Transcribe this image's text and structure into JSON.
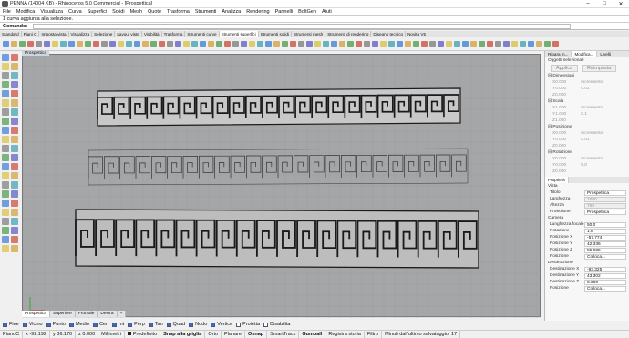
{
  "window": {
    "title": "PENNA (14004 KB) - Rhinoceros 5.0 Commercial - [Prospettica]"
  },
  "menu": [
    "File",
    "Modifica",
    "Visualizza",
    "Curva",
    "Superfici",
    "Solidi",
    "Mesh",
    "Quote",
    "Trasforma",
    "Strumenti",
    "Analizza",
    "Rendering",
    "Pannelli",
    "BoltGen",
    "Aiuti"
  ],
  "command": {
    "history": "1 curva aggiunta alla selezione.",
    "prompt": "Comando:"
  },
  "toolbar_tabs": [
    {
      "label": "Standard"
    },
    {
      "label": "Piani C"
    },
    {
      "label": "Imposta vista"
    },
    {
      "label": "Visualizza"
    },
    {
      "label": "Selezione"
    },
    {
      "label": "Layout viste"
    },
    {
      "label": "Visibilità"
    },
    {
      "label": "Trasforma"
    },
    {
      "label": "Strumenti curve"
    },
    {
      "label": "Strumenti superfici",
      "active": true
    },
    {
      "label": "Strumenti solidi"
    },
    {
      "label": "Strumenti mesh"
    },
    {
      "label": "Strumenti di rendering"
    },
    {
      "label": "Disegno tecnico"
    },
    {
      "label": "Novità V5"
    }
  ],
  "viewport": {
    "label": "Prospettica",
    "tabs": [
      "Prospettica",
      "Superiore",
      "Frontale",
      "Destra",
      "+"
    ]
  },
  "osnaps": [
    {
      "label": "Fine",
      "on": true
    },
    {
      "label": "Vicino",
      "on": true
    },
    {
      "label": "Punto",
      "on": true
    },
    {
      "label": "Medio",
      "on": true
    },
    {
      "label": "Cen",
      "on": true
    },
    {
      "label": "Int",
      "on": true
    },
    {
      "label": "Perp",
      "on": true
    },
    {
      "label": "Tan",
      "on": true
    },
    {
      "label": "Quad",
      "on": true
    },
    {
      "label": "Nodo",
      "on": true
    },
    {
      "label": "Vertice",
      "on": true
    },
    {
      "label": "Proietta",
      "on": false
    },
    {
      "label": "Disabilita",
      "on": false
    }
  ],
  "status": {
    "cplane": "PianoC",
    "x": "x -92.192",
    "y": "y 36.170",
    "z": "z 0.000",
    "units": "Millimetri",
    "layer": "Predefinito",
    "buttons": [
      "Snap alla griglia",
      "Orto",
      "Planare",
      "Osnap",
      "SmartTrack",
      "Gumball",
      "Registra storia",
      "Filtro"
    ],
    "message": "Minuti dall'ultimo salvataggio: 17"
  },
  "panel_top": {
    "tabs": [
      "Ripara m...",
      "Modifica...",
      "Livelli"
    ],
    "heading": "Oggetti selezionati",
    "mode_buttons": [
      "Applica",
      "Reimposta"
    ],
    "groups": [
      {
        "name": "Dimensioni",
        "rows": [
          {
            "axis": "X",
            "value": "0.000",
            "extra_label": "Incremento"
          },
          {
            "axis": "Y",
            "value": "0.000",
            "extra_value": "0.01"
          },
          {
            "axis": "Z",
            "value": "0.000"
          }
        ]
      },
      {
        "name": "Scala",
        "rows": [
          {
            "axis": "X",
            "value": "1.000",
            "extra_label": "Incremento"
          },
          {
            "axis": "Y",
            "value": "1.000",
            "extra_value": "0.1"
          },
          {
            "axis": "Z",
            "value": "1.000"
          }
        ]
      },
      {
        "name": "Posizione",
        "rows": [
          {
            "axis": "X",
            "value": "0.000",
            "extra_label": "Incremento"
          },
          {
            "axis": "Y",
            "value": "0.000",
            "extra_value": "0.01"
          },
          {
            "axis": "Z",
            "value": "0.000"
          }
        ]
      },
      {
        "name": "Rotazione",
        "rows": [
          {
            "axis": "X",
            "value": "0.000",
            "extra_label": "Incremento"
          },
          {
            "axis": "Y",
            "value": "0.000",
            "extra_value": "5.0"
          },
          {
            "axis": "Z",
            "value": "0.000"
          }
        ]
      }
    ]
  },
  "panel_props": {
    "tab": "Proprietà",
    "sections": [
      {
        "title": "Vista",
        "rows": [
          {
            "label": "Titolo",
            "value": "Prospettica"
          },
          {
            "label": "Larghezza",
            "value": "1080",
            "disabled": true
          },
          {
            "label": "Altezza",
            "value": "755",
            "disabled": true
          },
          {
            "label": "Proiezione",
            "value": "Prospettica"
          }
        ]
      },
      {
        "title": "Camera",
        "rows": [
          {
            "label": "Lunghezza focale",
            "value": "50.0"
          },
          {
            "label": "Rotazione",
            "value": "1.6"
          },
          {
            "label": "Posizione X",
            "value": "-57.774"
          },
          {
            "label": "Posizione Y",
            "value": "42.336"
          },
          {
            "label": "Posizione Z",
            "value": "56.686"
          },
          {
            "label": "Posizione",
            "value": "Colloca..."
          }
        ]
      },
      {
        "title": "Destinazione",
        "rows": [
          {
            "label": "Destinazione X",
            "value": "-93.325"
          },
          {
            "label": "Destinazione Y",
            "value": "43.302"
          },
          {
            "label": "Destinazione Z",
            "value": "0.660"
          },
          {
            "label": "Posizione",
            "value": "Colloca..."
          }
        ]
      }
    ]
  }
}
